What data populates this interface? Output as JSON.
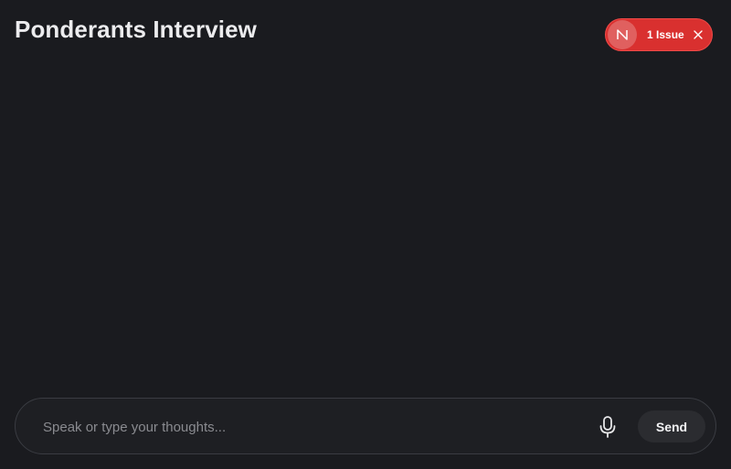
{
  "header": {
    "title": "Ponderants Interview"
  },
  "issue_badge": {
    "logo_letter": "N",
    "label": "1 Issue",
    "close_icon": "close-icon",
    "color": "#d9302f"
  },
  "composer": {
    "placeholder": "Speak or type your thoughts...",
    "value": "",
    "mic_icon": "microphone-icon",
    "send_label": "Send"
  },
  "theme": {
    "background": "#1a1b1f",
    "composer_border": "#3a3c42",
    "send_background": "#2b2c30"
  }
}
